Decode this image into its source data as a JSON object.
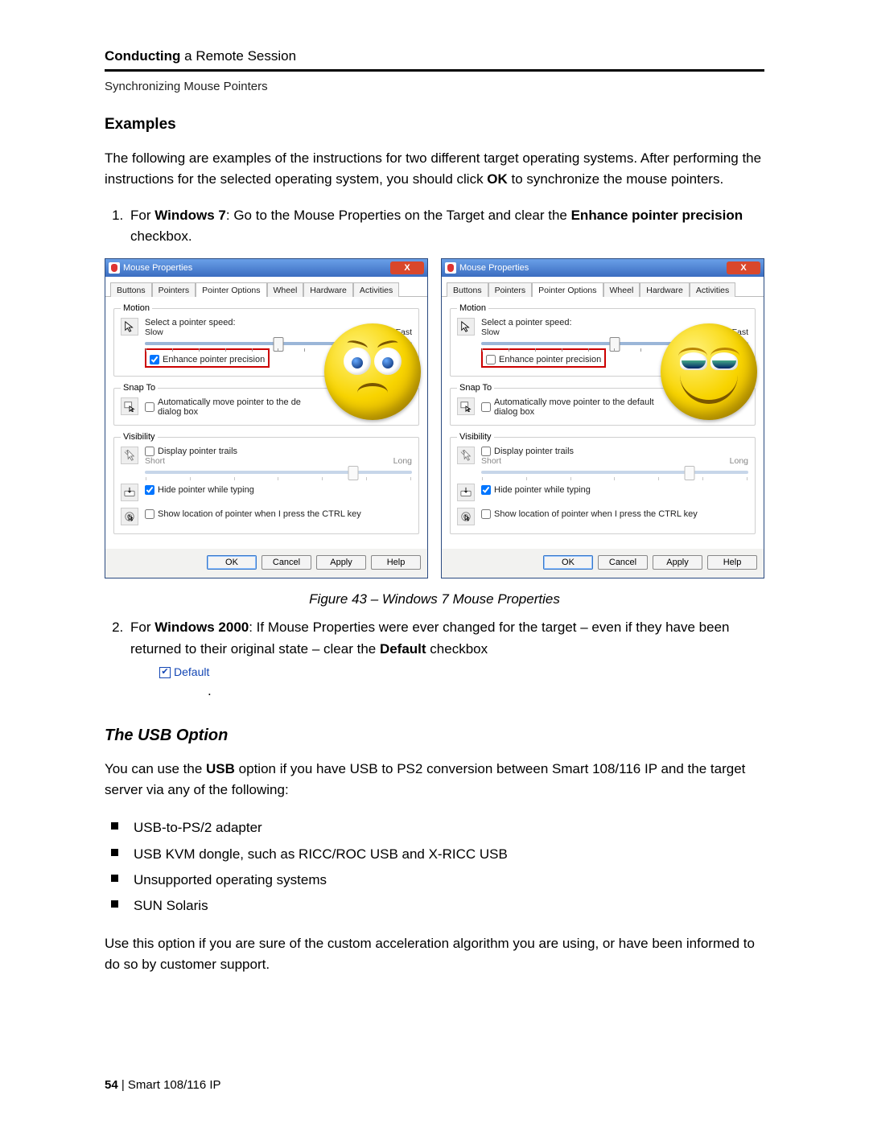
{
  "header": {
    "chapter_bold": "Conducting",
    "chapter_rest": " a Remote Session",
    "subsection": "Synchronizing Mouse Pointers"
  },
  "sec_examples": "Examples",
  "intro_a": "The following are examples of the instructions for two different target operating systems. After performing the instructions for the selected operating system, you should click ",
  "intro_ok": "OK",
  "intro_b": " to synchronize the mouse pointers.",
  "step1_a": "For ",
  "step1_os": "Windows 7",
  "step1_b": ": Go to the Mouse Properties on the Target and clear the ",
  "step1_opt": "Enhance pointer precision",
  "step1_c": " checkbox.",
  "dlg": {
    "title": "Mouse Properties",
    "close": "X",
    "tabs": [
      "Buttons",
      "Pointers",
      "Pointer Options",
      "Wheel",
      "Hardware",
      "Activities"
    ],
    "motion": "Motion",
    "speed": "Select a pointer speed:",
    "slow": "Slow",
    "fast": "Fast",
    "enh": "Enhance pointer precision",
    "snap": "Snap To",
    "snap_opt_left": "Automatically move pointer to the de",
    "snap_opt2_left": "dialog box",
    "snap_opt_right": "Automatically move pointer to the default",
    "snap_opt2_right": "dialog box",
    "vis": "Visibility",
    "trails": "Display pointer trails",
    "short": "Short",
    "long": "Long",
    "hide": "Hide pointer while typing",
    "ctrl": "Show location of pointer when I press the CTRL key",
    "ok": "OK",
    "cancel": "Cancel",
    "apply": "Apply",
    "help": "Help"
  },
  "caption": "Figure 43 – Windows 7 Mouse Properties",
  "step2_a": "For ",
  "step2_os": "Windows 2000",
  "step2_b": ": If Mouse Properties were ever changed for the target – even if they have been returned to their original state – clear the ",
  "step2_opt": "Default",
  "step2_c": " checkbox",
  "default_label": "Default",
  "default_dot": ".",
  "h_usb": "The USB Option",
  "usb_a": "You can use the ",
  "usb_b": "USB",
  "usb_c": " option if you have USB to PS2 conversion between Smart 108/116 IP and the target server via any of the following:",
  "bul": [
    "USB-to-PS/2 adapter",
    "USB KVM dongle, such as RICC/ROC USB and X-RICC USB",
    "Unsupported operating systems",
    "SUN Solaris"
  ],
  "closing": "Use this option if you are sure of the custom acceleration algorithm you are using, or have been informed to do so by customer support.",
  "footer_page": "54",
  "footer_sep": "  |  ",
  "footer_doc": "Smart 108/116 IP"
}
